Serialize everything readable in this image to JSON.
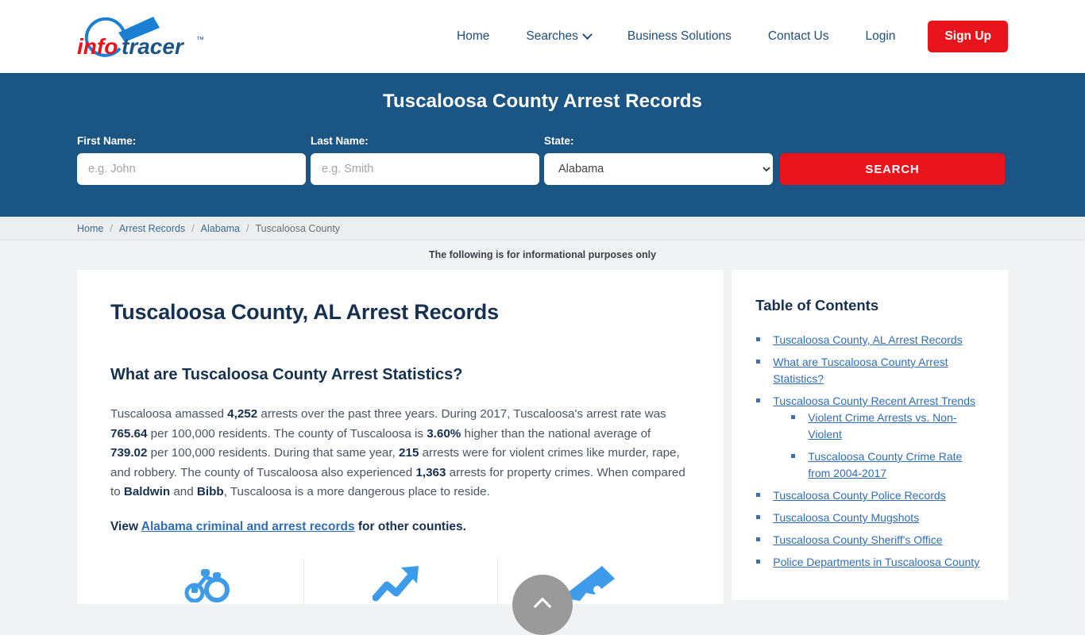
{
  "brand": {
    "name_part1": "info",
    "name_part2": "tracer",
    "trademark": "™",
    "color_red": "#e8131b",
    "color_blue": "#1b7fd4"
  },
  "nav": {
    "items": [
      {
        "label": "Home",
        "has_caret": false
      },
      {
        "label": "Searches",
        "has_caret": true
      },
      {
        "label": "Business Solutions",
        "has_caret": false
      },
      {
        "label": "Contact Us",
        "has_caret": false
      },
      {
        "label": "Login",
        "has_caret": false
      }
    ],
    "signup_label": "Sign Up"
  },
  "search_band": {
    "title": "Tuscaloosa County Arrest Records",
    "background_color": "#1b5584",
    "first_name": {
      "label": "First Name:",
      "value": "",
      "placeholder": "e.g. John"
    },
    "last_name": {
      "label": "Last Name:",
      "value": "",
      "placeholder": "e.g. Smith"
    },
    "state": {
      "label": "State:",
      "selected": "Alabama",
      "options": [
        "Alabama"
      ]
    },
    "search_button": "SEARCH"
  },
  "breadcrumb": {
    "separator": "/",
    "items": [
      {
        "label": "Home",
        "current": false
      },
      {
        "label": "Arrest Records",
        "current": false
      },
      {
        "label": "Alabama",
        "current": false
      },
      {
        "label": "Tuscaloosa County",
        "current": true
      }
    ]
  },
  "notice": "The following is for informational purposes only",
  "main": {
    "page_title": "Tuscaloosa County, AL Arrest Records",
    "section_title": "What are Tuscaloosa County Arrest Statistics?",
    "paragraph": {
      "t1": "Tuscaloosa amassed ",
      "b1": "4,252",
      "t2": " arrests over the past three years. During 2017, Tuscaloosa's arrest rate was ",
      "b2": "765.64",
      "t3": " per 100,000 residents. The county of Tuscaloosa is ",
      "b3": "3.60%",
      "t4": " higher than the national average of ",
      "b4": "739.02",
      "t5": " per 100,000 residents. During that same year, ",
      "b5": "215",
      "t6": " arrests were for violent crimes like murder, rape, and robbery. The county of Tuscaloosa also experienced ",
      "b6": "1,363",
      "t7": " arrests for property crimes. When compared to ",
      "b7": "Baldwin",
      "t8": " and ",
      "b8": "Bibb",
      "t9": ", Tuscaloosa is a more dangerous place to reside."
    },
    "view_line": {
      "prefix": "View ",
      "link": "Alabama criminal and arrest records",
      "suffix": " for other counties."
    },
    "icons": [
      {
        "name": "handcuffs-icon"
      },
      {
        "name": "trend-up-arrow-icon"
      },
      {
        "name": "pistol-icon"
      }
    ]
  },
  "toc": {
    "title": "Table of Contents",
    "items": [
      {
        "label": "Tuscaloosa County, AL Arrest Records",
        "children": []
      },
      {
        "label": "What are Tuscaloosa County Arrest Statistics?",
        "children": []
      },
      {
        "label": "Tuscaloosa County Recent Arrest Trends",
        "children": [
          {
            "label": "Violent Crime Arrests vs. Non-Violent"
          },
          {
            "label": "Tuscaloosa County Crime Rate from 2004-2017"
          }
        ]
      },
      {
        "label": "Tuscaloosa County Police Records",
        "children": []
      },
      {
        "label": "Tuscaloosa County Mugshots",
        "children": []
      },
      {
        "label": "Tuscaloosa County Sheriff's Office",
        "children": []
      },
      {
        "label": "Police Departments in Tuscaloosa County",
        "children": []
      }
    ]
  },
  "scroll_top": {
    "name": "scroll-to-top-button",
    "color": "#9a9a9a"
  }
}
